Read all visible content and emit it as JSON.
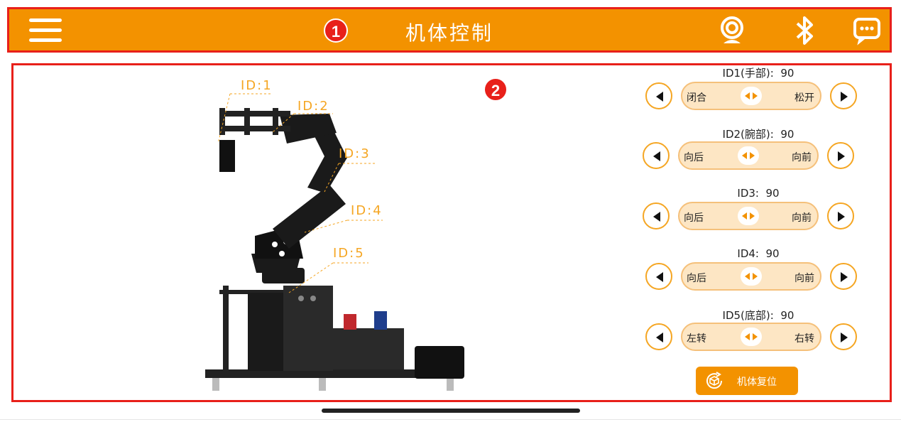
{
  "header": {
    "title": "机体控制",
    "badge": "1",
    "icons": [
      "menu-icon",
      "webcam-icon",
      "bluetooth-icon",
      "chat-icon"
    ],
    "color": "#F39200"
  },
  "main": {
    "badge": "2",
    "id_labels": [
      "ID:1",
      "ID:2",
      "ID:3",
      "ID:4",
      "ID:5"
    ]
  },
  "servos": [
    {
      "label": "ID1(手部):",
      "value": "90",
      "left_text": "闭合",
      "right_text": "松开"
    },
    {
      "label": "ID2(腕部):",
      "value": "90",
      "left_text": "向后",
      "right_text": "向前"
    },
    {
      "label": "ID3:",
      "value": "90",
      "left_text": "向后",
      "right_text": "向前"
    },
    {
      "label": "ID4:",
      "value": "90",
      "left_text": "向后",
      "right_text": "向前"
    },
    {
      "label": "ID5(底部):",
      "value": "90",
      "left_text": "左转",
      "right_text": "右转"
    }
  ],
  "reset_button": {
    "label": "机体复位"
  },
  "colors": {
    "accent": "#F39200",
    "highlight": "#E8201A",
    "slider_fill": "#FDE6C4"
  }
}
